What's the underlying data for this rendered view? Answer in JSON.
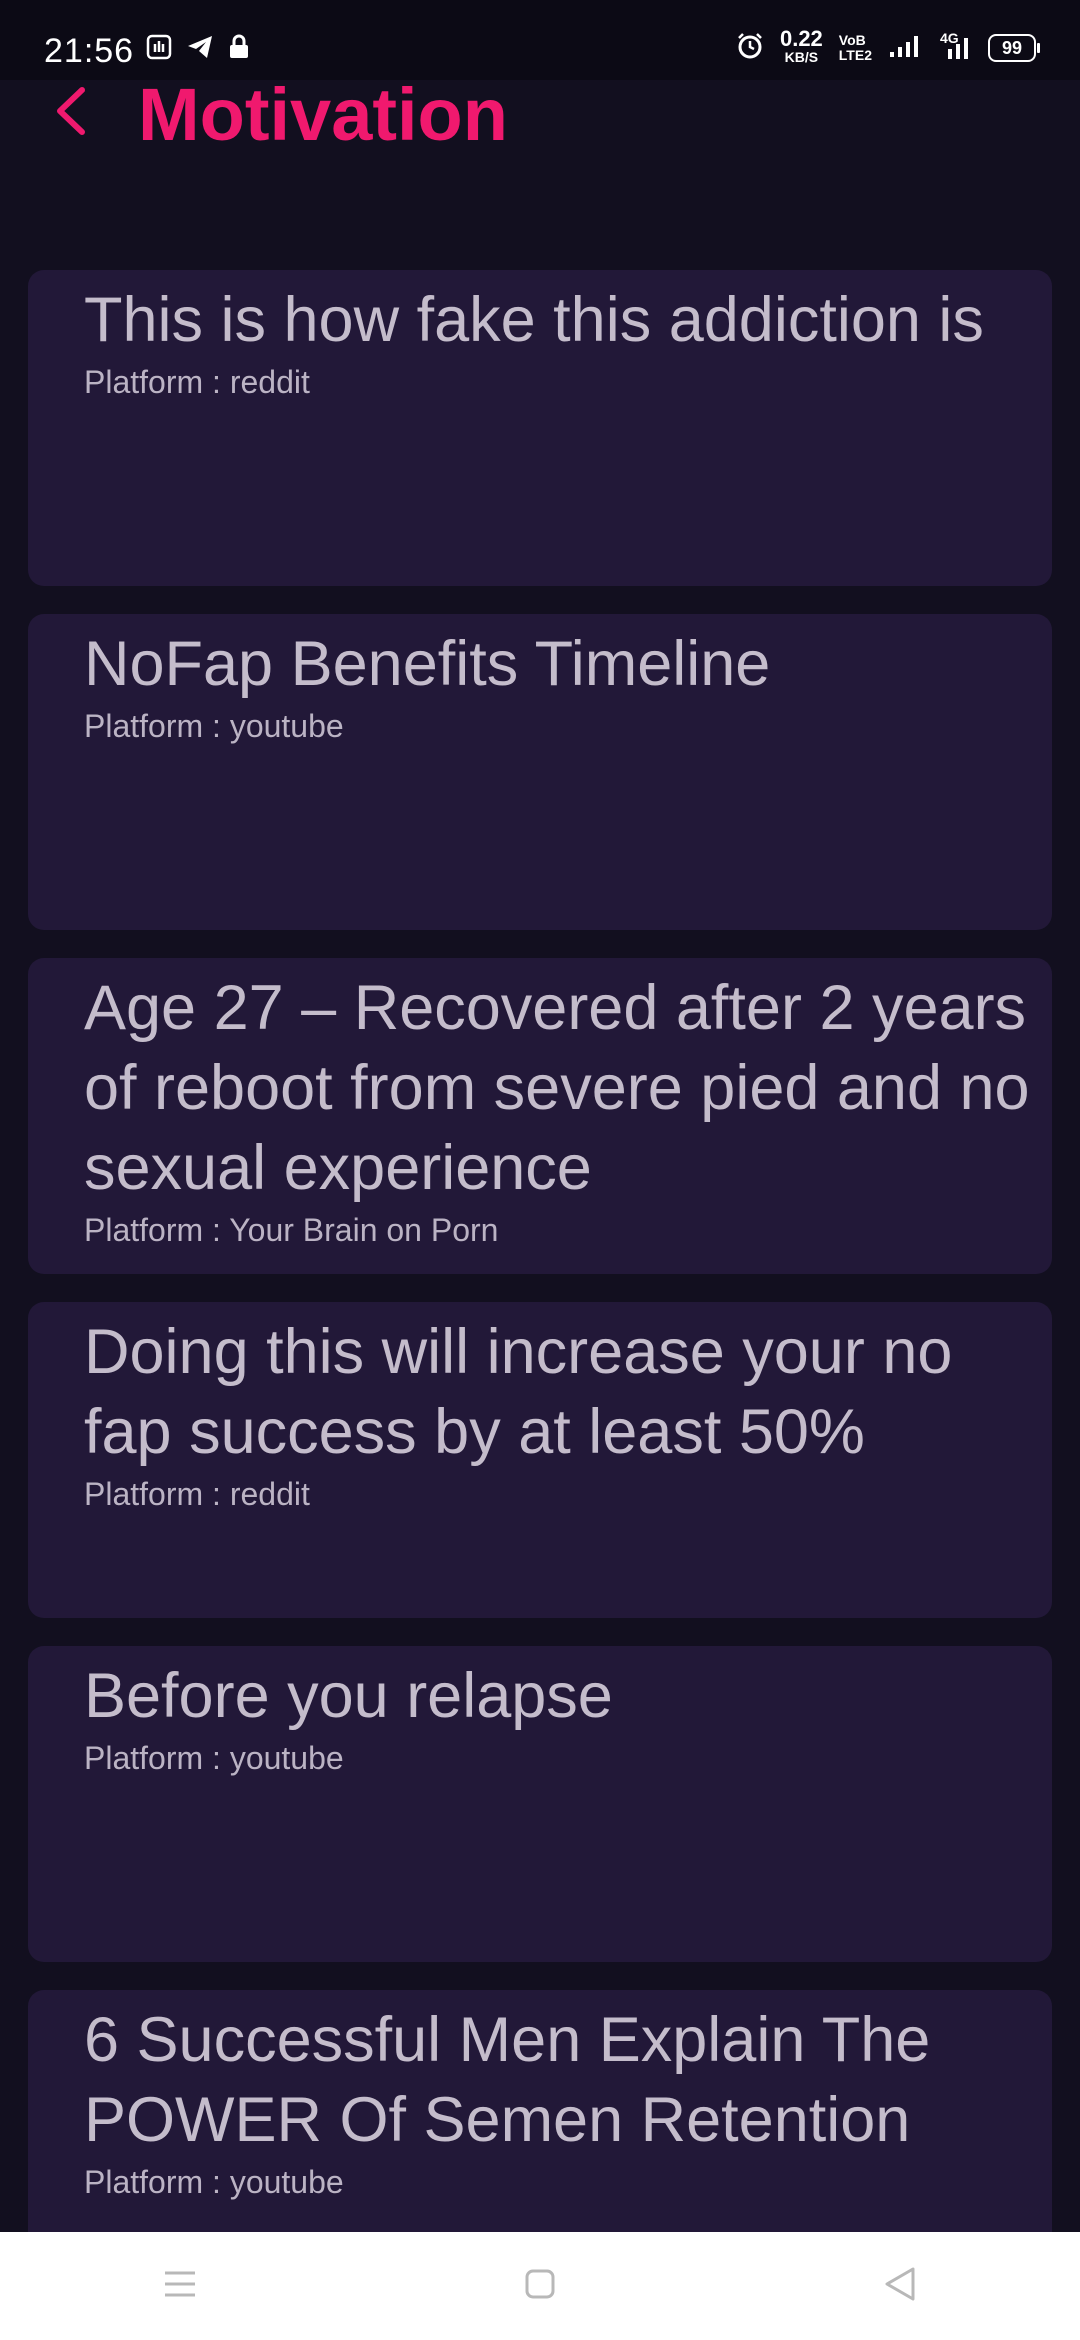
{
  "status_bar": {
    "time": "21:56",
    "net_speed_value": "0.22",
    "net_speed_unit": "KB/S",
    "volte_top": "VoB",
    "volte_bottom": "LTE2",
    "network_type": "4G",
    "battery": "99",
    "icons": [
      "gesture-icon",
      "telegram-icon",
      "lock-icon",
      "alarm-icon",
      "signal-icon",
      "signal-4g-icon"
    ]
  },
  "header": {
    "title": "Motivation",
    "back_icon": "chevron-left-icon"
  },
  "colors": {
    "accent": "#f0196e",
    "background": "#120f1f",
    "card": "#221838",
    "text": "#c4bccb"
  },
  "cards": [
    {
      "title": "This is how fake this addiction is",
      "platform": "Platform : reddit"
    },
    {
      "title": "NoFap Benefits Timeline",
      "platform": "Platform : youtube"
    },
    {
      "title": "Age 27 – Recovered after 2 years of reboot from severe pied and no sexual experience",
      "platform": "Platform : Your Brain on Porn"
    },
    {
      "title": "Doing this will increase your no fap success by at least 50%",
      "platform": "Platform : reddit"
    },
    {
      "title": "Before you relapse",
      "platform": "Platform : youtube"
    },
    {
      "title": "6 Successful Men Explain The POWER Of Semen Retention",
      "platform": "Platform : youtube"
    }
  ],
  "nav_bar": {
    "icons": [
      "menu-icon",
      "home-square-icon",
      "back-triangle-icon"
    ]
  }
}
